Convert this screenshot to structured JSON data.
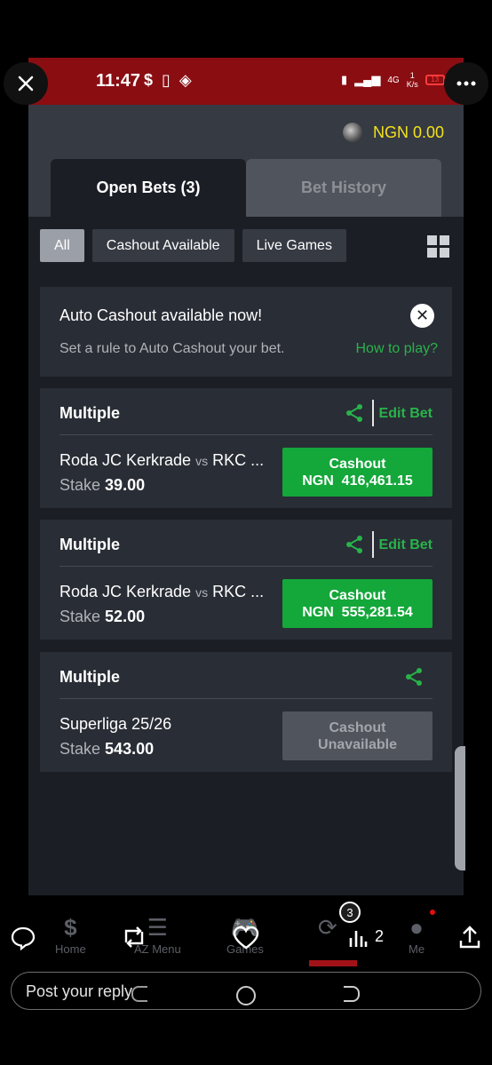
{
  "status_bar": {
    "time": "11:47",
    "left_icons": [
      "$",
      "▯",
      "◈"
    ],
    "network": "4G",
    "speed_value": "1",
    "speed_unit": "K/s",
    "battery": "13"
  },
  "header": {
    "balance": "NGN 0.00"
  },
  "tabs": [
    {
      "label": "Open Bets (3)",
      "active": true
    },
    {
      "label": "Bet History",
      "active": false
    }
  ],
  "filters": [
    {
      "label": "All",
      "active": true
    },
    {
      "label": "Cashout Available",
      "active": false
    },
    {
      "label": "Live Games",
      "active": false
    }
  ],
  "auto_cashout": {
    "title": "Auto Cashout available now!",
    "subtitle": "Set a rule to Auto Cashout your bet.",
    "link": "How to play?"
  },
  "bets": [
    {
      "type": "Multiple",
      "edit_label": "Edit Bet",
      "home": "Roda JC Kerkrade",
      "vs": "vs",
      "away": "RKC ...",
      "stake_label": "Stake",
      "stake": "39.00",
      "cashout_label": "Cashout",
      "cashout_amount": "NGN  416,461.15"
    },
    {
      "type": "Multiple",
      "edit_label": "Edit Bet",
      "home": "Roda JC Kerkrade",
      "vs": "vs",
      "away": "RKC ...",
      "stake_label": "Stake",
      "stake": "52.00",
      "cashout_label": "Cashout",
      "cashout_amount": "NGN  555,281.54"
    },
    {
      "type": "Multiple",
      "match": "Superliga 25/26",
      "stake_label": "Stake",
      "stake": "543.00",
      "cashout_line1": "Cashout",
      "cashout_line2": "Unavailable"
    }
  ],
  "bottom_nav": {
    "home": "Home",
    "menu": "AZ Menu",
    "games": "Games",
    "me": "Me",
    "badge": "3",
    "stats_count": "2"
  },
  "reply": {
    "placeholder": "Post your reply"
  },
  "colors": {
    "status_bar": "#8a0d12",
    "balance": "#f4e21a",
    "accent_green": "#14a73a",
    "card": "#292d35"
  }
}
